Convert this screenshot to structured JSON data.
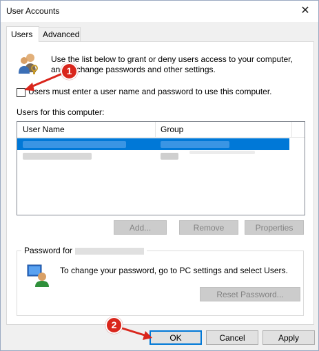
{
  "window": {
    "title": "User Accounts",
    "close_glyph": "✕"
  },
  "tabs": [
    {
      "label": "Users",
      "active": true
    },
    {
      "label": "Advanced",
      "active": false
    }
  ],
  "intro": {
    "line1": "Use the list below to grant or deny users access to your computer,",
    "line2": "and to change passwords and other settings."
  },
  "checkbox": {
    "label": "Users must enter a user name and password to use this computer.",
    "checked": false
  },
  "users_section": {
    "label": "Users for this computer:",
    "columns": [
      "User Name",
      "Group"
    ]
  },
  "buttons": {
    "add": "Add...",
    "remove": "Remove",
    "properties": "Properties",
    "reset_password": "Reset Password...",
    "ok": "OK",
    "cancel": "Cancel",
    "apply": "Apply"
  },
  "password_group": {
    "title": "Password for",
    "text": "To change your password, go to PC settings and select Users."
  },
  "annotations": [
    {
      "number": "1",
      "color": "#d9261c"
    },
    {
      "number": "2",
      "color": "#d9261c"
    }
  ],
  "colors": {
    "selection": "#0078d7",
    "annotation": "#d9261c"
  }
}
